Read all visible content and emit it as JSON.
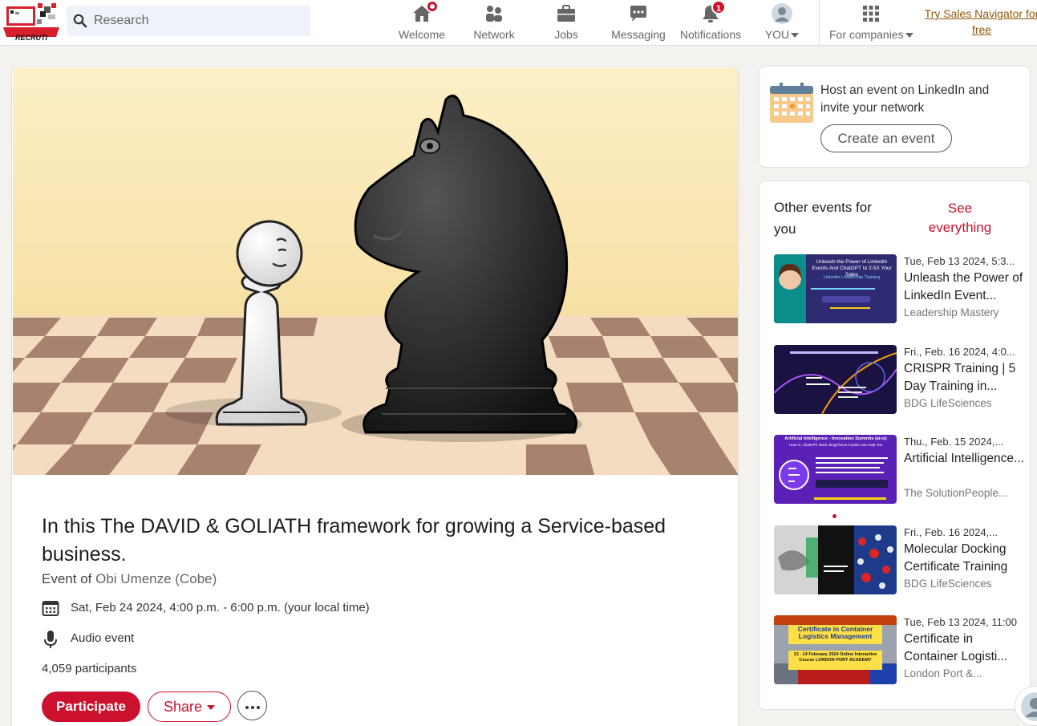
{
  "header": {
    "logo_text": "RECRUTI",
    "search_placeholder": "Research",
    "nav": [
      {
        "label": "Welcome",
        "icon": "home-icon",
        "badge": ""
      },
      {
        "label": "Network",
        "icon": "network-icon",
        "badge": ""
      },
      {
        "label": "Jobs",
        "icon": "briefcase-icon",
        "badge": ""
      },
      {
        "label": "Messaging",
        "icon": "messaging-icon",
        "badge": ""
      },
      {
        "label": "Notifications",
        "icon": "bell-icon",
        "badge": "1"
      },
      {
        "label": "YOU",
        "icon": "avatar",
        "badge": ""
      },
      {
        "label": "For companies",
        "icon": "grid-icon",
        "badge": ""
      }
    ],
    "sales_navigator": "Try Sales Navigator for free"
  },
  "event": {
    "title": "In this The DAVID & GOLIATH framework for growing a Service-based business.",
    "organizer_prefix": "Event of",
    "organizer": "Obi Umenze (Cobe)",
    "datetime": "Sat, Feb 24 2024, 4:00 p.m. - 6:00 p.m. (your local time)",
    "type": "Audio event",
    "participants": "4,059 participants",
    "participate_label": "Participate",
    "share_label": "Share"
  },
  "host": {
    "text": "Host an event on LinkedIn and invite your network",
    "create_label": "Create an event"
  },
  "other_events": {
    "heading": "Other events for you",
    "see_all": "See everything",
    "items": [
      {
        "date": "Tue, Feb 13 2024, 5:3...",
        "title": "Unleash the Power of LinkedIn Event...",
        "host": "Leadership Mastery",
        "thumb_title": "Unleash the Power of LinkedIn Events And ChatGPT to 2-5X Your Sales",
        "thumb_sub": "LinkedIn Leadership Training"
      },
      {
        "date": "Fri., Feb. 16 2024, 4:0...",
        "title": "CRISPR Training | 5 Day Training in...",
        "host": "BDG LifeSciences",
        "thumb_title": "",
        "thumb_sub": ""
      },
      {
        "date": "Thu., Feb. 15 2024,...",
        "title": "Artificial Intelligence...",
        "host": "The SolutionPeople...",
        "thumb_title": "Artificial Intelligence - Innovation Summits (ai-is)",
        "thumb_sub": "How AI, ChatGPT, Bard, BingChat & Copilot Can Help You"
      },
      {
        "date": "Fri., Feb. 16 2024,...",
        "title": "Molecular Docking Certificate Training",
        "host": "BDG LifeSciences",
        "thumb_title": "",
        "thumb_sub": ""
      },
      {
        "date": "Tue, Feb 13 2024, 11:00",
        "title": "Certificate in Container Logisti...",
        "host": "London Port &...",
        "thumb_title": "Certificate in Container Logistics Management",
        "thumb_sub": "13 - 14 February 2024 Online Interactive Course LONDON PORT ACADEMY"
      }
    ]
  },
  "colors": {
    "accent": "#cb112d",
    "background": "#f4f2ee",
    "sales_link": "#915907"
  }
}
